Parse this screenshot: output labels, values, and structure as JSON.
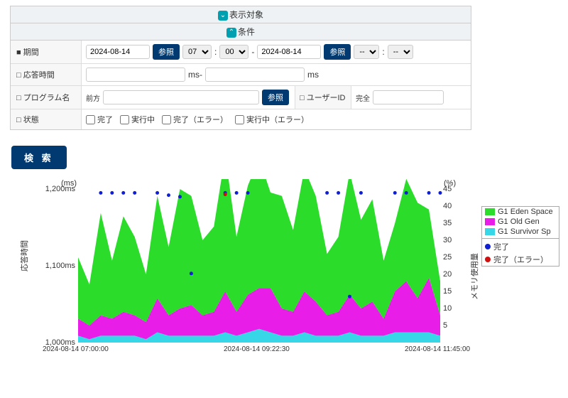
{
  "sections": {
    "display_target": "表示対象",
    "conditions": "条件"
  },
  "filters": {
    "period_label": "■ 期間",
    "date_from": "2024-08-14",
    "hour_from": "07",
    "min_from": "00",
    "date_to": "2024-08-14",
    "hour_to": "--",
    "min_to": "--",
    "ref_btn": "参照",
    "response_label": "□ 応答時間",
    "ms_sep": "ms-",
    "ms_suffix": "ms",
    "program_label": "□ プログラム名",
    "program_prefix": "前方",
    "userid_label": "□ ユーザーID",
    "userid_prefix": "完全",
    "status_label": "□ 状態",
    "status_done": "完了",
    "status_running": "実行中",
    "status_done_err": "完了（エラー）",
    "status_running_err": "実行中（エラー）"
  },
  "search_btn": "検 索",
  "chart_data": {
    "type": "area",
    "x_ticks": [
      "2024-08-14 07:00:00",
      "2024-08-14 09:22:30",
      "2024-08-14 11:45:00"
    ],
    "left_axis": {
      "unit": "(ms)",
      "label": "応答時間",
      "ticks": [
        "1,200ms",
        "1,100ms",
        "1,000ms"
      ],
      "range": [
        1000,
        1200
      ]
    },
    "right_axis": {
      "unit": "(%)",
      "label": "メモリ使用量",
      "ticks": [
        45,
        40,
        35,
        30,
        25,
        20,
        15,
        10,
        5
      ],
      "range": [
        0,
        45
      ]
    },
    "series": [
      {
        "name": "G1 Eden Space",
        "color": "#2bdc2b",
        "values": [
          18,
          12,
          30,
          17,
          28,
          23,
          14,
          30,
          20,
          35,
          32,
          22,
          25,
          40,
          22,
          32,
          38,
          28,
          33,
          24,
          36,
          31,
          18,
          22,
          36,
          26,
          30,
          17,
          20,
          30,
          28,
          20,
          10
        ]
      },
      {
        "name": "G1 Old Gen",
        "color": "#e81ee8",
        "values": [
          5,
          4,
          6,
          5,
          7,
          6,
          5,
          10,
          6,
          8,
          9,
          6,
          7,
          12,
          7,
          11,
          12,
          13,
          8,
          7,
          12,
          10,
          6,
          7,
          11,
          8,
          10,
          5,
          12,
          15,
          10,
          16,
          6
        ]
      },
      {
        "name": "G1 Survivor Sp",
        "color": "#38d7e8",
        "values": [
          2,
          1,
          2,
          2,
          2,
          2,
          1,
          3,
          2,
          2,
          2,
          2,
          2,
          3,
          2,
          3,
          4,
          3,
          2,
          2,
          3,
          2,
          2,
          2,
          3,
          2,
          2,
          2,
          3,
          3,
          3,
          3,
          2
        ]
      }
    ],
    "scatter": [
      {
        "name": "完了",
        "color": "#1020d0",
        "points_x": [
          2,
          3,
          4,
          5,
          7,
          8,
          9,
          10,
          13,
          14,
          15,
          22,
          23,
          24,
          25,
          28,
          29,
          31,
          32
        ],
        "points_y": [
          1195,
          1195,
          1195,
          1195,
          1195,
          1192,
          1190,
          1090,
          1195,
          1195,
          1195,
          1195,
          1195,
          1060,
          1195,
          1195,
          1195,
          1195,
          1195
        ]
      },
      {
        "name": "完了（エラー）",
        "color": "#d01010",
        "points_x": [
          13
        ],
        "points_y": [
          1193
        ]
      }
    ],
    "n_points": 33
  },
  "legend": {
    "eden": "G1 Eden Space",
    "old": "G1 Old Gen",
    "surv": "G1 Survivor Sp",
    "done": "完了",
    "done_err": "完了（エラー）"
  }
}
